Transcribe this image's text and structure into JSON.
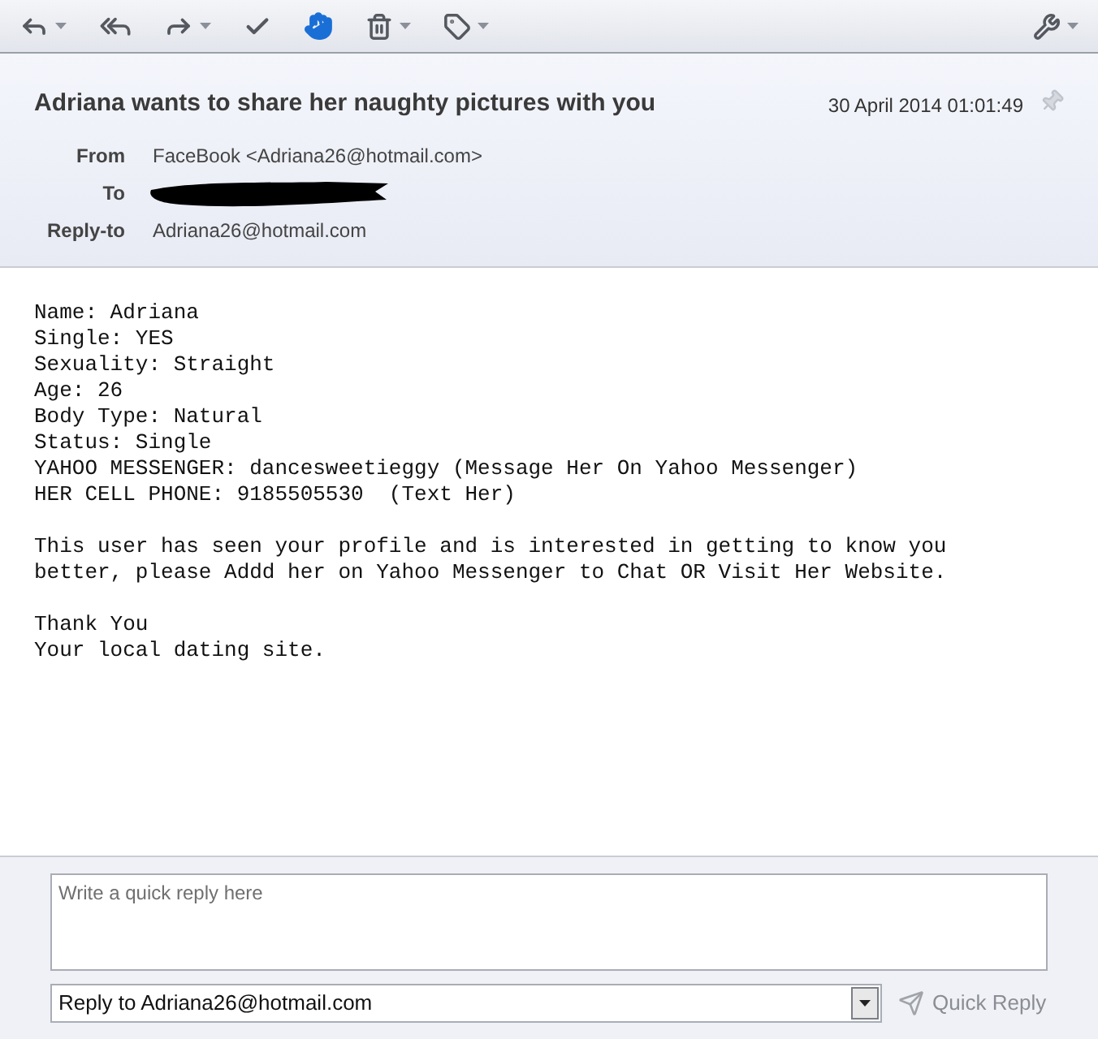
{
  "message": {
    "subject": "Adriana wants to share her naughty pictures with you",
    "date": "30 April 2014 01:01:49",
    "fields": [
      {
        "label": "From",
        "value": "FaceBook <Adriana26@hotmail.com>",
        "kind": "text"
      },
      {
        "label": "To",
        "kind": "redacted"
      },
      {
        "label": "Reply-to",
        "value": "Adriana26@hotmail.com",
        "kind": "text"
      }
    ],
    "body": [
      [
        "Name: Adriana",
        "Single: YES",
        "Sexuality: Straight",
        "Age: 26",
        "Body Type: Natural",
        "Status: Single",
        "YAHOO MESSENGER: dancesweetieggy (Message Her On Yahoo Messenger)",
        "HER CELL PHONE: 9185505530  (Text Her)"
      ],
      [
        "This user has seen your profile and is interested in getting to know you",
        "better, please Addd her on Yahoo Messenger to Chat OR Visit Her Website."
      ],
      [
        "Thank You",
        "Your local dating site."
      ]
    ]
  },
  "quick_reply": {
    "placeholder": "Write a quick reply here",
    "recipient": "Reply to Adriana26@hotmail.com",
    "button": "Quick Reply",
    "disabled": true
  }
}
